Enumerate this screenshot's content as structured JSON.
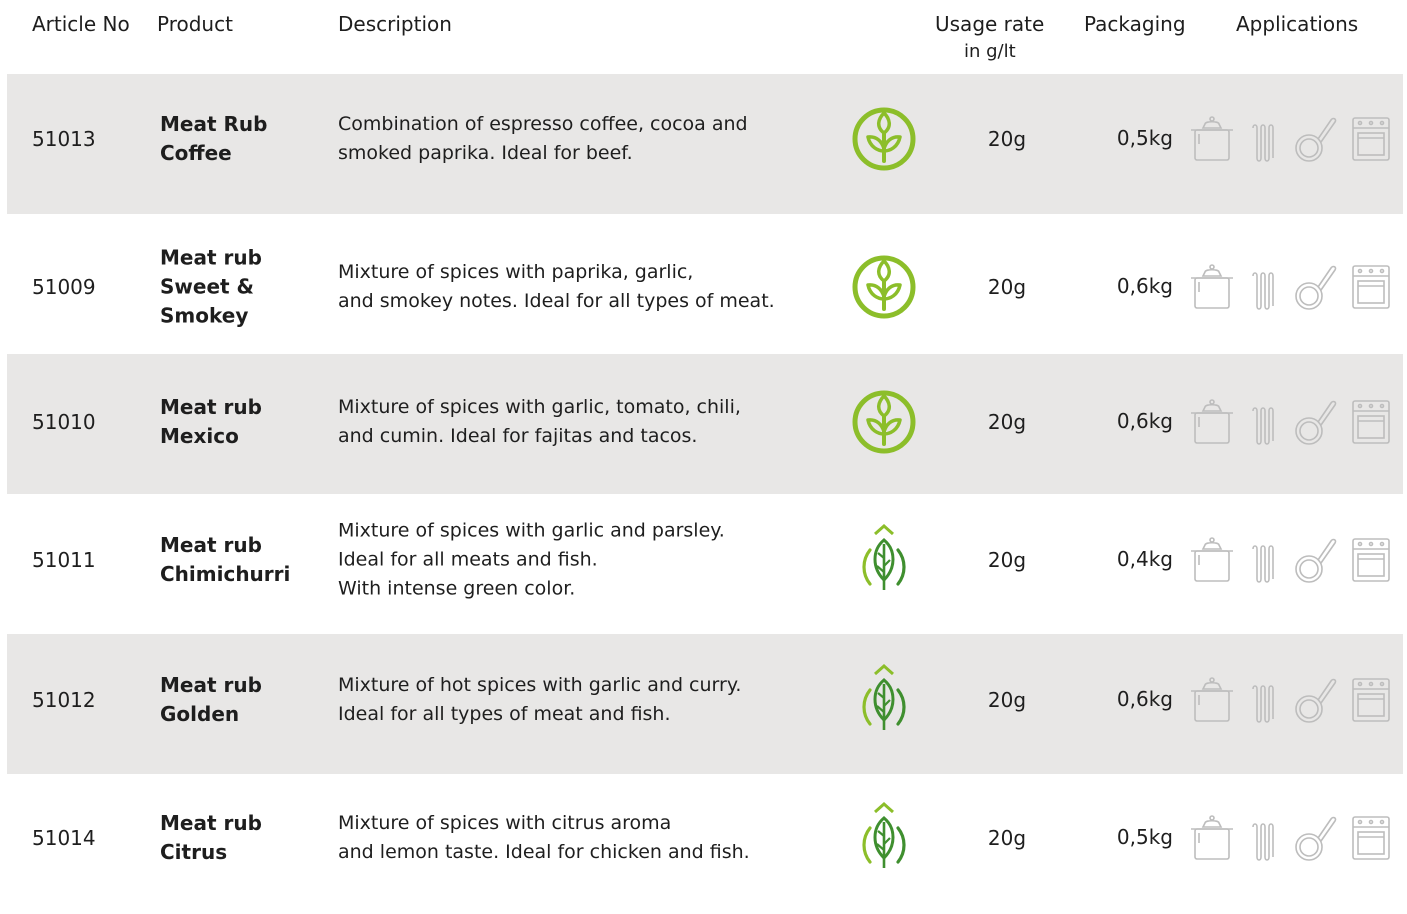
{
  "headers": {
    "article_no": "Article No",
    "product": "Product",
    "description": "Description",
    "usage_rate": "Usage rate",
    "usage_unit": "in g/lt",
    "packaging": "Packaging",
    "applications": "Applications"
  },
  "rows": [
    {
      "article": "51013",
      "product_lines": [
        "Meat Rub",
        "Coffee"
      ],
      "description_lines": [
        "Combination of espresso coffee, cocoa and",
        "smoked paprika. Ideal for beef."
      ],
      "badge": "plant-circle-icon",
      "usage": "20g",
      "packaging": "0,5kg",
      "shaded": true
    },
    {
      "article": "51009",
      "product_lines": [
        "Meat rub",
        "Sweet &",
        "Smokey"
      ],
      "description_lines": [
        "Mixture of spices with paprika, garlic,",
        "and smokey notes. Ideal for all types of meat."
      ],
      "badge": "plant-circle-icon",
      "usage": "20g",
      "packaging": "0,6kg",
      "shaded": false
    },
    {
      "article": "51010",
      "product_lines": [
        "Meat rub",
        "Mexico"
      ],
      "description_lines": [
        "Mixture of spices with garlic, tomato, chili,",
        "and cumin. Ideal for fajitas and tacos."
      ],
      "badge": "plant-circle-icon",
      "usage": "20g",
      "packaging": "0,6kg",
      "shaded": true
    },
    {
      "article": "51011",
      "product_lines": [
        "Meat rub",
        "Chimichurri"
      ],
      "description_lines": [
        "Mixture of spices with garlic and parsley.",
        "Ideal for all meats and fish.",
        "With intense green color."
      ],
      "badge": "leaf-icon",
      "usage": "20g",
      "packaging": "0,4kg",
      "shaded": false
    },
    {
      "article": "51012",
      "product_lines": [
        "Meat rub",
        "Golden"
      ],
      "description_lines": [
        "Mixture of hot spices with garlic and curry.",
        "Ideal for all types of meat and fish."
      ],
      "badge": "leaf-icon",
      "usage": "20g",
      "packaging": "0,6kg",
      "shaded": true
    },
    {
      "article": "51014",
      "product_lines": [
        "Meat rub",
        "Citrus"
      ],
      "description_lines": [
        "Mixture of spices with citrus aroma",
        "and lemon taste. Ideal for chicken and fish."
      ],
      "badge": "leaf-icon",
      "usage": "20g",
      "packaging": "0,5kg",
      "shaded": false
    }
  ],
  "application_icons": [
    "pot-icon",
    "grill-icon",
    "pan-icon",
    "oven-icon"
  ],
  "colors": {
    "row_shade": "#e8e7e6",
    "badge_green": "#8cbe2a",
    "badge_dark_green": "#3f8f2f",
    "app_icon_grey": "#bdbdbd"
  }
}
